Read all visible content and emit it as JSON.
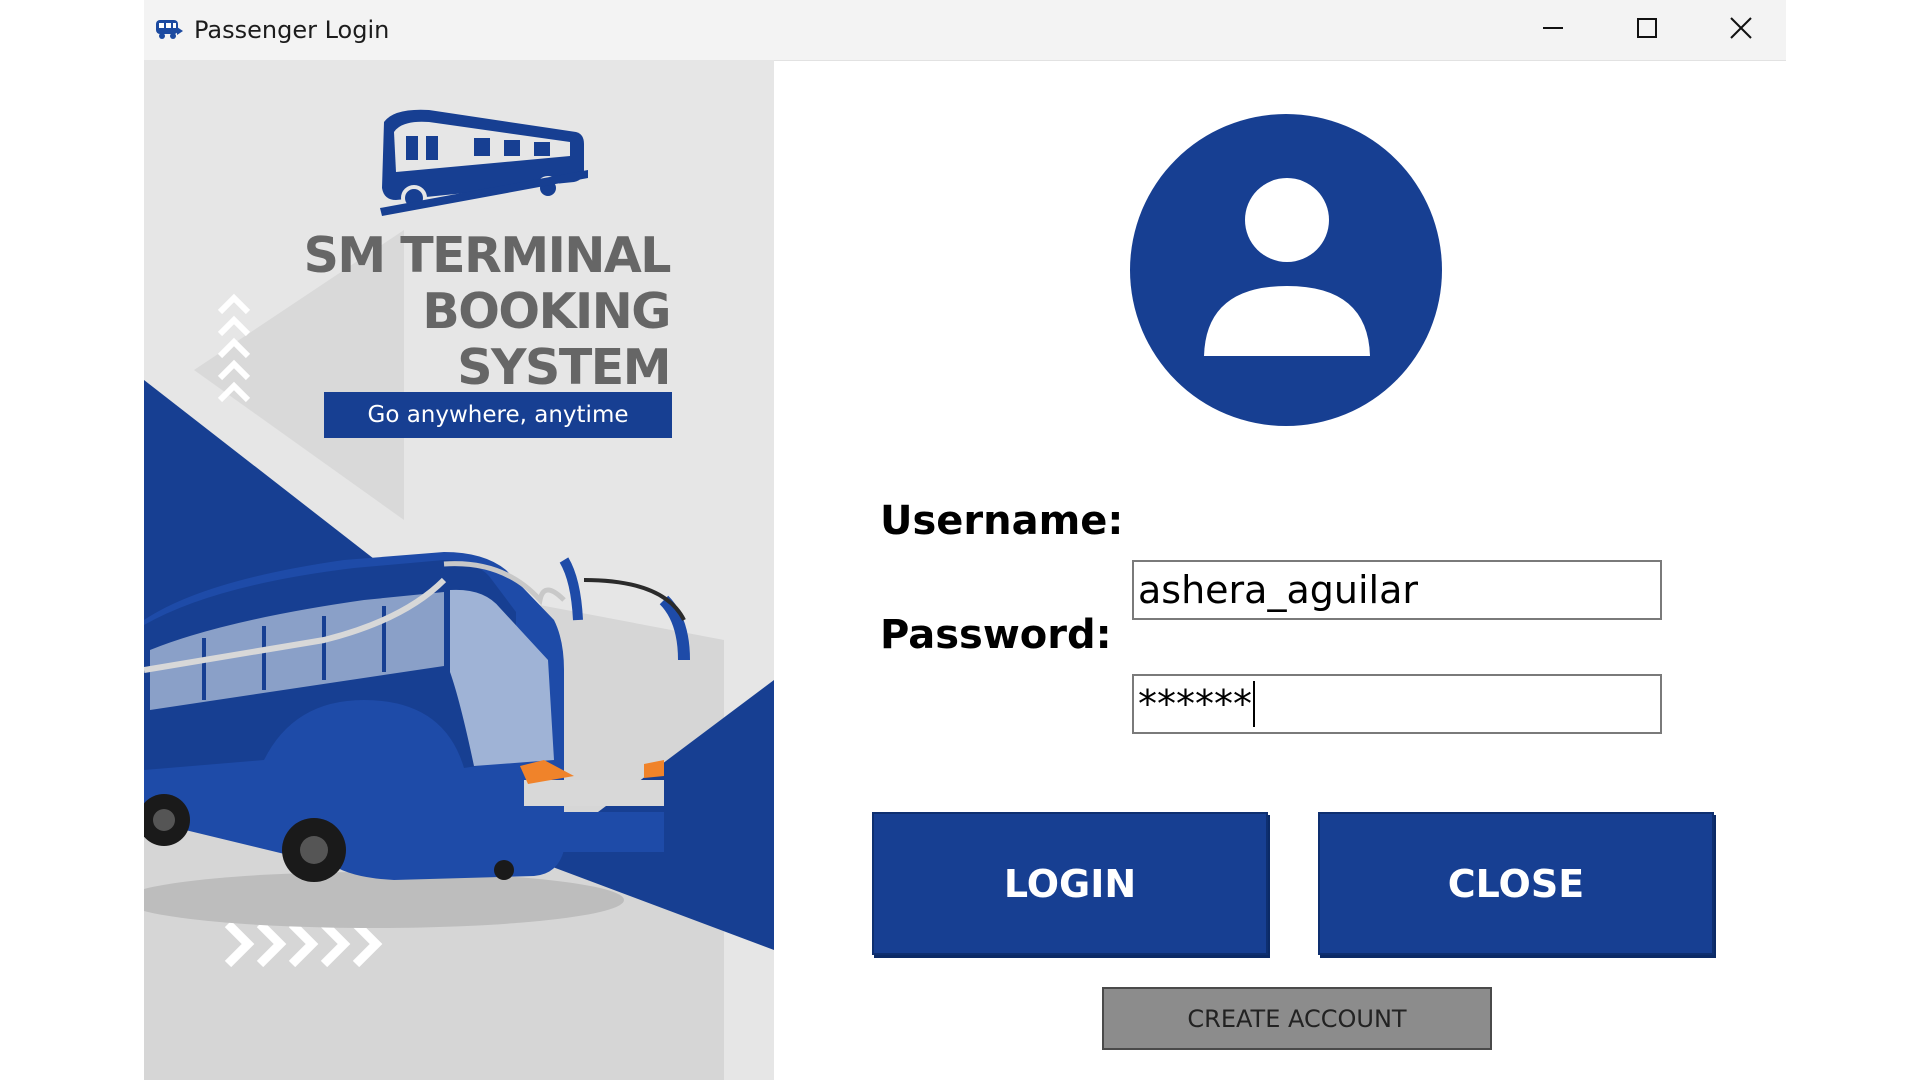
{
  "window": {
    "title": "Passenger Login",
    "controls": {
      "minimize": "minimize",
      "maximize": "maximize",
      "close": "close"
    }
  },
  "branding": {
    "title": "SM TERMINAL\nBOOKING\nSYSTEM",
    "tagline": "Go anywhere, anytime"
  },
  "form": {
    "username_label": "Username:",
    "username_value": "ashera_aguilar",
    "password_label": "Password:",
    "password_value": "******"
  },
  "buttons": {
    "login": "LOGIN",
    "close": "CLOSE",
    "create_account": "CREATE ACCOUNT"
  },
  "colors": {
    "brand_blue": "#173f92",
    "panel_gray": "#e6e6e6",
    "title_gray": "#666666",
    "create_button_gray": "#8c8c8c"
  },
  "icons": [
    "app-bus-icon",
    "minimize-icon",
    "maximize-icon",
    "close-icon",
    "bus-logo-icon",
    "chevron-up-icon",
    "chevron-right-icon",
    "user-avatar-icon"
  ]
}
